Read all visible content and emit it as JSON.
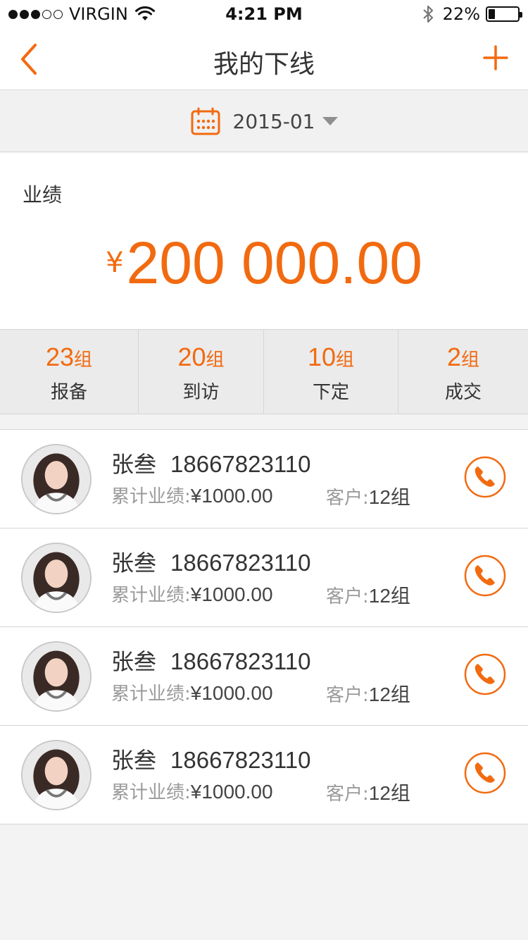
{
  "status_bar": {
    "carrier": "VIRGIN",
    "time": "4:21 PM",
    "battery_percent": "22%",
    "battery_level": 0.22
  },
  "nav": {
    "title": "我的下线",
    "back_icon": "chevron-left-icon",
    "add_icon": "plus-icon"
  },
  "date_filter": {
    "value": "2015-01",
    "icon": "calendar-icon"
  },
  "performance": {
    "label": "业绩",
    "currency": "¥",
    "amount": "200 000.00"
  },
  "stats": [
    {
      "value": "23",
      "unit": "组",
      "label": "报备"
    },
    {
      "value": "20",
      "unit": "组",
      "label": "到访"
    },
    {
      "value": "10",
      "unit": "组",
      "label": "下定"
    },
    {
      "value": "2",
      "unit": "组",
      "label": "成交"
    }
  ],
  "members": [
    {
      "name": "张叁",
      "phone": "18667823110",
      "perf_label": "累计业绩:",
      "perf_value": "¥1000.00",
      "cust_label": "客户:",
      "cust_value": "12组"
    },
    {
      "name": "张叁",
      "phone": "18667823110",
      "perf_label": "累计业绩:",
      "perf_value": "¥1000.00",
      "cust_label": "客户:",
      "cust_value": "12组"
    },
    {
      "name": "张叁",
      "phone": "18667823110",
      "perf_label": "累计业绩:",
      "perf_value": "¥1000.00",
      "cust_label": "客户:",
      "cust_value": "12组"
    },
    {
      "name": "张叁",
      "phone": "18667823110",
      "perf_label": "累计业绩:",
      "perf_value": "¥1000.00",
      "cust_label": "客户:",
      "cust_value": "12组"
    }
  ],
  "colors": {
    "accent": "#f26a10",
    "divider": "#d6d6d6"
  }
}
